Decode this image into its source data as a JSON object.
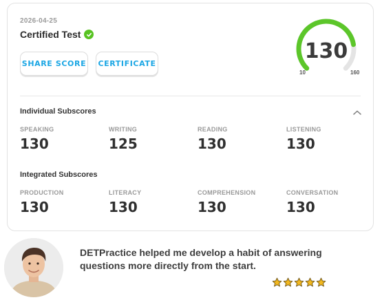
{
  "result": {
    "date": "2026-04-25",
    "title": "Certified Test",
    "share_label": "SHARE SCORE",
    "certificate_label": "CERTIFICATE"
  },
  "gauge": {
    "score": "130",
    "min": "10",
    "max": "160",
    "fill_fraction": 0.8,
    "color_fill": "#5cc62a",
    "color_track": "#e4e4e4"
  },
  "individual": {
    "title": "Individual Subscores",
    "items": [
      {
        "label": "SPEAKING",
        "value": "130"
      },
      {
        "label": "WRITING",
        "value": "125"
      },
      {
        "label": "READING",
        "value": "130"
      },
      {
        "label": "LISTENING",
        "value": "130"
      }
    ]
  },
  "integrated": {
    "title": "Integrated Subscores",
    "items": [
      {
        "label": "PRODUCTION",
        "value": "130"
      },
      {
        "label": "LITERACY",
        "value": "130"
      },
      {
        "label": "COMPREHENSION",
        "value": "130"
      },
      {
        "label": "CONVERSATION",
        "value": "130"
      }
    ]
  },
  "testimonial": {
    "quote": "DETPractice helped me develop a habit of answering questions more directly from the start.",
    "rating": 5,
    "star_color": "#f2b81f"
  }
}
